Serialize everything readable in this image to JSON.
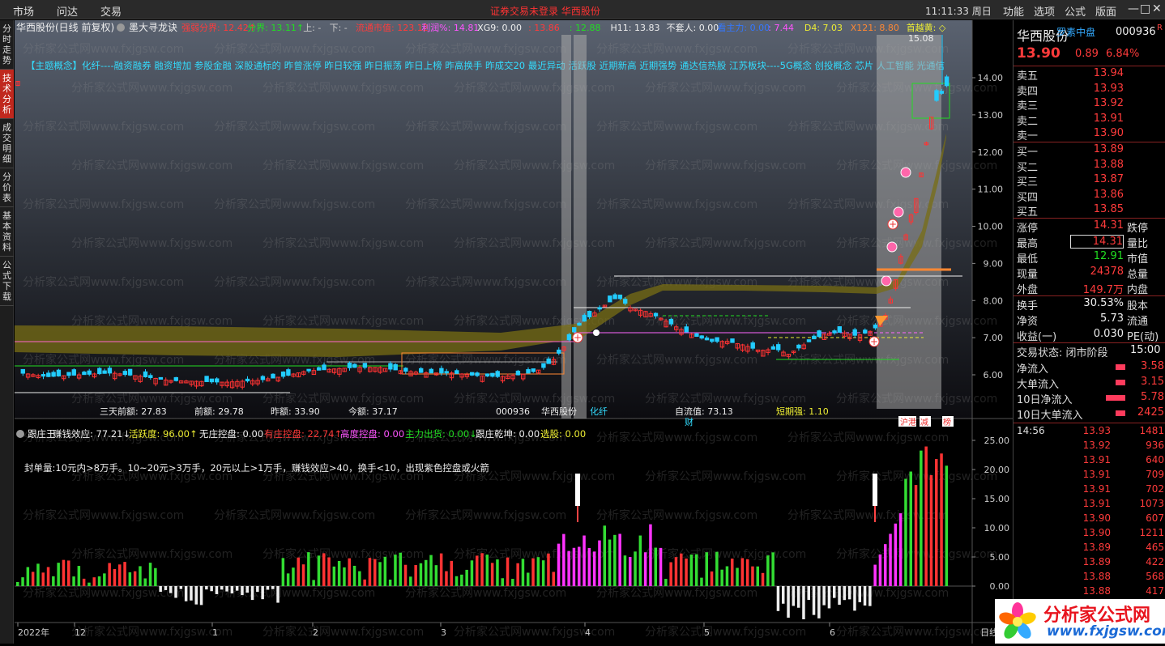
{
  "menu": [
    "市场",
    "问达",
    "交易"
  ],
  "notice": "证券交易未登录  华西股份",
  "clock": "11:11:33 周日",
  "right_menu": [
    "功能",
    "选项",
    "公式",
    "版面"
  ],
  "window_btns": [
    "—",
    "□",
    "✕"
  ],
  "side_tabs": [
    {
      "label": "分时走势",
      "active": false
    },
    {
      "label": "技术分析",
      "active": true
    },
    {
      "label": "成交明细",
      "active": false
    },
    {
      "label": "分价表",
      "active": false
    },
    {
      "label": "基本资料",
      "active": false
    },
    {
      "label": "公式下载",
      "active": false
    }
  ],
  "main_header": {
    "stock": "华西股份(日线 前复权)",
    "formula": "墨大寻龙诀",
    "items": [
      {
        "t": "强弱分界: 12.42↑",
        "c": "#ff3b3b"
      },
      {
        "t": "分界: 13.11↑",
        "c": "#22dd22"
      },
      {
        "t": "上: -",
        "c": "#ccc"
      },
      {
        "t": "下: -",
        "c": "#ccc"
      },
      {
        "t": "流通市值: 123.12",
        "c": "#ff3b3b"
      },
      {
        "t": "利润%: 14.81",
        "c": "#ff55ff"
      },
      {
        "t": "XG9: 0.00",
        "c": "#eee"
      },
      {
        "t": ": 13.86",
        "c": "#ff3b3b"
      },
      {
        "t": ": 12.88",
        "c": "#22dd22"
      },
      {
        "t": "H11: 13.83",
        "c": "#eee"
      },
      {
        "t": "不套人: 0.00",
        "c": "#eee"
      },
      {
        "t": "看主力: 0.00",
        "c": "#3377ff"
      },
      {
        "t": ": 7.44",
        "c": "#ff55ff"
      },
      {
        "t": "D4: 7.03",
        "c": "#eeee33"
      },
      {
        "t": "X121: 8.80",
        "c": "#ff8833"
      },
      {
        "t": "首越黄: ◇",
        "c": "#eeee33"
      }
    ]
  },
  "concept_text": "【主题概念】化纤----融资融券 融资增加 参股金融 深股通标的 昨曾涨停 昨日较强 昨日振荡 昨日上榜 昨高换手 昨成交20 最近异动 活跃股 近期新高 近期强势 通达信热股 江苏板块----5G概念 创投概念 芯片 人工智能 光通信",
  "price_axis": [
    "14.00",
    "13.00",
    "12.00",
    "11.00",
    "10.00",
    "9.00",
    "8.00",
    "7.00",
    "6.00"
  ],
  "main_labels": {
    "three_day": "三天前额: 27.83",
    "before": "前额: 29.78",
    "yesterday": "昨额: 33.90",
    "today": "今额: 37.17",
    "code": "000936",
    "name": "华西股份",
    "industry": "化纤",
    "free_float": "自流值: 73.13",
    "short_strength": "短期强: 1.10",
    "fin": "财",
    "high_label": "15.08",
    "b1": "沪港",
    "b2": "减",
    "b3": "榜"
  },
  "sub_header": [
    {
      "t": "跟庄王",
      "c": "#eee"
    },
    {
      "t": "赚钱效应: 77.21↓",
      "c": "#eee"
    },
    {
      "t": "活跃度: 96.00↑",
      "c": "#eeee33"
    },
    {
      "t": "无庄控盘: 0.00",
      "c": "#eee"
    },
    {
      "t": "有庄控盘: 22.74↑",
      "c": "#ff3b3b"
    },
    {
      "t": "高度控盘: 0.00",
      "c": "#ff55ff"
    },
    {
      "t": "主力出货: 0.00↓",
      "c": "#22dd22"
    },
    {
      "t": "跟庄乾坤: 0.00",
      "c": "#eee"
    },
    {
      "t": "选股: 0.00",
      "c": "#eeee33"
    }
  ],
  "sub_note": "封单量:10元内>8万手。10~20元>3万手，20元以上>1万手，赚钱效应>40，换手<10，出现紫色控盘或火箭",
  "sub_axis": [
    "25.00",
    "20.00",
    "15.00",
    "10.00",
    "5.00",
    "0.00"
  ],
  "x_axis": [
    "2022年",
    "12",
    "1",
    "2",
    "3",
    "4",
    "5",
    "6"
  ],
  "x_axis_right": "日线",
  "quote": {
    "name": "华西股份",
    "tag": "罗素中盘",
    "code": "000936",
    "r": "R",
    "price": "13.90",
    "change": "0.89",
    "pct": "6.84%",
    "asks": [
      [
        "卖五",
        "13.94"
      ],
      [
        "卖四",
        "13.93"
      ],
      [
        "卖三",
        "13.92"
      ],
      [
        "卖二",
        "13.91"
      ],
      [
        "卖一",
        "13.90"
      ]
    ],
    "bids": [
      [
        "买一",
        "13.89"
      ],
      [
        "买二",
        "13.88"
      ],
      [
        "买三",
        "13.87"
      ],
      [
        "买四",
        "13.86"
      ],
      [
        "买五",
        "13.85"
      ]
    ],
    "stats": [
      {
        "l": "涨停",
        "v": "14.31",
        "c": "red",
        "l2": "跌停"
      },
      {
        "l": "最高",
        "v": "14.31",
        "c": "red",
        "l2": "量比",
        "box": true
      },
      {
        "l": "最低",
        "v": "12.91",
        "c": "green",
        "l2": "市值"
      },
      {
        "l": "现量",
        "v": "24378",
        "c": "red",
        "l2": "总量"
      },
      {
        "l": "外盘",
        "v": "149.7万",
        "c": "red",
        "l2": "内盘"
      }
    ],
    "stats2": [
      {
        "l": "换手",
        "v": "30.53%",
        "l2": "股本"
      },
      {
        "l": "净资",
        "v": "5.73",
        "l2": "流通"
      },
      {
        "l": "收益(一)",
        "v": "0.030",
        "l2": "PE(动)"
      }
    ],
    "status_label": "交易状态: 闭市阶段",
    "status_time": "15:00",
    "flows": [
      [
        "净流入",
        "3.58"
      ],
      [
        "大单流入",
        "3.15"
      ],
      [
        "10日净流入",
        "5.78"
      ],
      [
        "10日大单流入",
        "2425"
      ]
    ],
    "ticks": [
      [
        "14:56",
        "13.93",
        "1481"
      ],
      [
        "",
        "13.92",
        "936"
      ],
      [
        "",
        "13.91",
        "640"
      ],
      [
        "",
        "13.91",
        "709"
      ],
      [
        "",
        "13.91",
        "702"
      ],
      [
        "",
        "13.91",
        "1073"
      ],
      [
        "",
        "13.90",
        "607"
      ],
      [
        "",
        "13.90",
        "1211"
      ],
      [
        "",
        "13.89",
        "465"
      ],
      [
        "",
        "13.89",
        "422"
      ],
      [
        "",
        "13.88",
        "568"
      ],
      [
        "",
        "13.88",
        "417"
      ]
    ]
  },
  "watermark": "分析家公式网www.fxjgsw.com",
  "logo_title": "分析家公式网",
  "logo_url": "www.fxjgsw.com"
}
